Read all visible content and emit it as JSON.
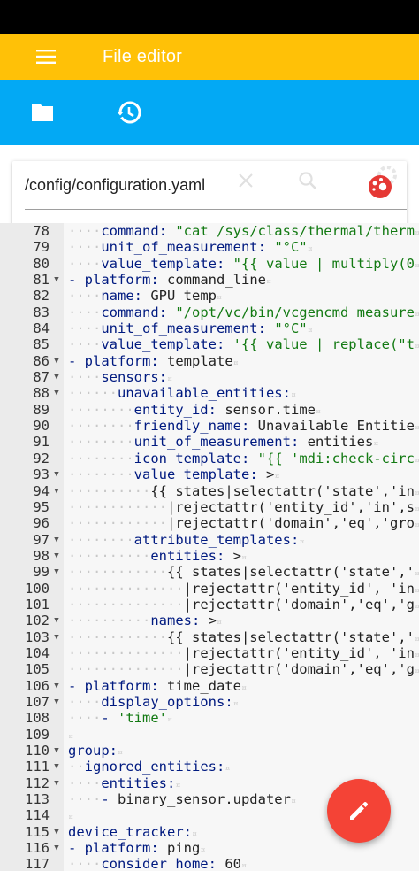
{
  "app": {
    "title": "File editor"
  },
  "file": {
    "path": "/config/configuration.yaml"
  },
  "colors": {
    "appbar": "#FFC107",
    "toolbar": "#03A9F4",
    "fab": "#F44336",
    "string": "#137a13",
    "key": "#001a80"
  },
  "icons": {
    "menu": "menu-icon",
    "folder": "folder-icon",
    "history": "history-icon",
    "clear": "close-icon",
    "search": "search-icon",
    "settings": "gear-icon",
    "edit": "pencil-icon"
  },
  "code_lines": [
    {
      "n": "78",
      "fold": false,
      "indent": 2,
      "dash": false,
      "key": "command",
      "sep": ": ",
      "val": "\"cat /sys/class/thermal/therm",
      "str": true
    },
    {
      "n": "79",
      "fold": false,
      "indent": 2,
      "dash": false,
      "key": "unit_of_measurement",
      "sep": ": ",
      "val": "\"°C\"",
      "str": true
    },
    {
      "n": "80",
      "fold": false,
      "indent": 2,
      "dash": false,
      "key": "value_template",
      "sep": ": ",
      "val": "\"{{ value | multiply(0",
      "str": true
    },
    {
      "n": "81",
      "fold": true,
      "indent": 1,
      "dash": true,
      "key": "platform",
      "sep": ": ",
      "val": "command_line",
      "str": false
    },
    {
      "n": "82",
      "fold": false,
      "indent": 2,
      "dash": false,
      "key": "name",
      "sep": ": ",
      "val": "GPU temp",
      "str": false
    },
    {
      "n": "83",
      "fold": false,
      "indent": 2,
      "dash": false,
      "key": "command",
      "sep": ": ",
      "val": "\"/opt/vc/bin/vcgencmd measure",
      "str": true
    },
    {
      "n": "84",
      "fold": false,
      "indent": 2,
      "dash": false,
      "key": "unit_of_measurement",
      "sep": ": ",
      "val": "\"°C\"",
      "str": true
    },
    {
      "n": "85",
      "fold": false,
      "indent": 2,
      "dash": false,
      "key": "value_template",
      "sep": ": ",
      "val": "'{{ value | replace(\"t",
      "str": true
    },
    {
      "n": "86",
      "fold": true,
      "indent": 1,
      "dash": true,
      "key": "platform",
      "sep": ": ",
      "val": "template",
      "str": false
    },
    {
      "n": "87",
      "fold": true,
      "indent": 2,
      "dash": false,
      "key": "sensors",
      "sep": ":",
      "val": "",
      "str": false
    },
    {
      "n": "88",
      "fold": true,
      "indent": 3,
      "dash": false,
      "key": "unavailable_entities",
      "sep": ":",
      "val": "",
      "str": false
    },
    {
      "n": "89",
      "fold": false,
      "indent": 4,
      "dash": false,
      "key": "entity_id",
      "sep": ": ",
      "val": "sensor.time",
      "str": false
    },
    {
      "n": "90",
      "fold": false,
      "indent": 4,
      "dash": false,
      "key": "friendly_name",
      "sep": ": ",
      "val": "Unavailable Entitie",
      "str": false
    },
    {
      "n": "91",
      "fold": false,
      "indent": 4,
      "dash": false,
      "key": "unit_of_measurement",
      "sep": ": ",
      "val": "entities",
      "str": false
    },
    {
      "n": "92",
      "fold": false,
      "indent": 4,
      "dash": false,
      "key": "icon_template",
      "sep": ": ",
      "val": "\"{{ 'mdi:check-circ",
      "str": true
    },
    {
      "n": "93",
      "fold": true,
      "indent": 4,
      "dash": false,
      "key": "value_template",
      "sep": ": ",
      "val": ">",
      "str": false
    },
    {
      "n": "94",
      "fold": true,
      "indent": 5,
      "dash": false,
      "key": "",
      "sep": "",
      "val": "{{ states|selectattr('state','in",
      "str": false
    },
    {
      "n": "95",
      "fold": false,
      "indent": 6,
      "dash": false,
      "key": "",
      "sep": "",
      "val": "|rejectattr('entity_id','in',s",
      "str": false
    },
    {
      "n": "96",
      "fold": false,
      "indent": 6,
      "dash": false,
      "key": "",
      "sep": "",
      "val": "|rejectattr('domain','eq','gro",
      "str": false
    },
    {
      "n": "97",
      "fold": true,
      "indent": 4,
      "dash": false,
      "key": "attribute_templates",
      "sep": ":",
      "val": "",
      "str": false
    },
    {
      "n": "98",
      "fold": true,
      "indent": 5,
      "dash": false,
      "key": "entities",
      "sep": ": ",
      "val": ">",
      "str": false
    },
    {
      "n": "99",
      "fold": true,
      "indent": 6,
      "dash": false,
      "key": "",
      "sep": "",
      "val": "{{ states|selectattr('state','",
      "str": false
    },
    {
      "n": "100",
      "fold": false,
      "indent": 7,
      "dash": false,
      "key": "",
      "sep": "",
      "val": "|rejectattr('entity_id', 'in",
      "str": false
    },
    {
      "n": "101",
      "fold": false,
      "indent": 7,
      "dash": false,
      "key": "",
      "sep": "",
      "val": "|rejectattr('domain','eq','g",
      "str": false
    },
    {
      "n": "102",
      "fold": true,
      "indent": 5,
      "dash": false,
      "key": "names",
      "sep": ": ",
      "val": ">",
      "str": false
    },
    {
      "n": "103",
      "fold": true,
      "indent": 6,
      "dash": false,
      "key": "",
      "sep": "",
      "val": "{{ states|selectattr('state','",
      "str": false
    },
    {
      "n": "104",
      "fold": false,
      "indent": 7,
      "dash": false,
      "key": "",
      "sep": "",
      "val": "|rejectattr('entity_id', 'in",
      "str": false
    },
    {
      "n": "105",
      "fold": false,
      "indent": 7,
      "dash": false,
      "key": "",
      "sep": "",
      "val": "|rejectattr('domain','eq','g",
      "str": false
    },
    {
      "n": "106",
      "fold": true,
      "indent": 1,
      "dash": true,
      "key": "platform",
      "sep": ": ",
      "val": "time_date",
      "str": false
    },
    {
      "n": "107",
      "fold": true,
      "indent": 2,
      "dash": false,
      "key": "display_options",
      "sep": ":",
      "val": "",
      "str": false
    },
    {
      "n": "108",
      "fold": false,
      "indent": 3,
      "dash": true,
      "key": "",
      "sep": "",
      "val": "'time'",
      "str": true
    },
    {
      "n": "109",
      "fold": false,
      "indent": 0,
      "dash": false,
      "key": "",
      "sep": "",
      "val": "",
      "str": false
    },
    {
      "n": "110",
      "fold": true,
      "indent": 0,
      "dash": false,
      "key": "group",
      "sep": ":",
      "val": "",
      "str": false
    },
    {
      "n": "111",
      "fold": true,
      "indent": 1,
      "dash": false,
      "key": "ignored_entities",
      "sep": ":",
      "val": "",
      "str": false
    },
    {
      "n": "112",
      "fold": true,
      "indent": 2,
      "dash": false,
      "key": "entities",
      "sep": ":",
      "val": "",
      "str": false
    },
    {
      "n": "113",
      "fold": false,
      "indent": 3,
      "dash": true,
      "key": "",
      "sep": "",
      "val": "binary_sensor.updater",
      "str": false
    },
    {
      "n": "114",
      "fold": false,
      "indent": 0,
      "dash": false,
      "key": "",
      "sep": "",
      "val": "",
      "str": false
    },
    {
      "n": "115",
      "fold": true,
      "indent": 0,
      "dash": false,
      "key": "device_tracker",
      "sep": ":",
      "val": "",
      "str": false
    },
    {
      "n": "116",
      "fold": true,
      "indent": 1,
      "dash": true,
      "key": "platform",
      "sep": ": ",
      "val": "ping",
      "str": false
    },
    {
      "n": "117",
      "fold": false,
      "indent": 2,
      "dash": false,
      "key": "consider_home",
      "sep": ": ",
      "val": "60",
      "str": false
    }
  ]
}
